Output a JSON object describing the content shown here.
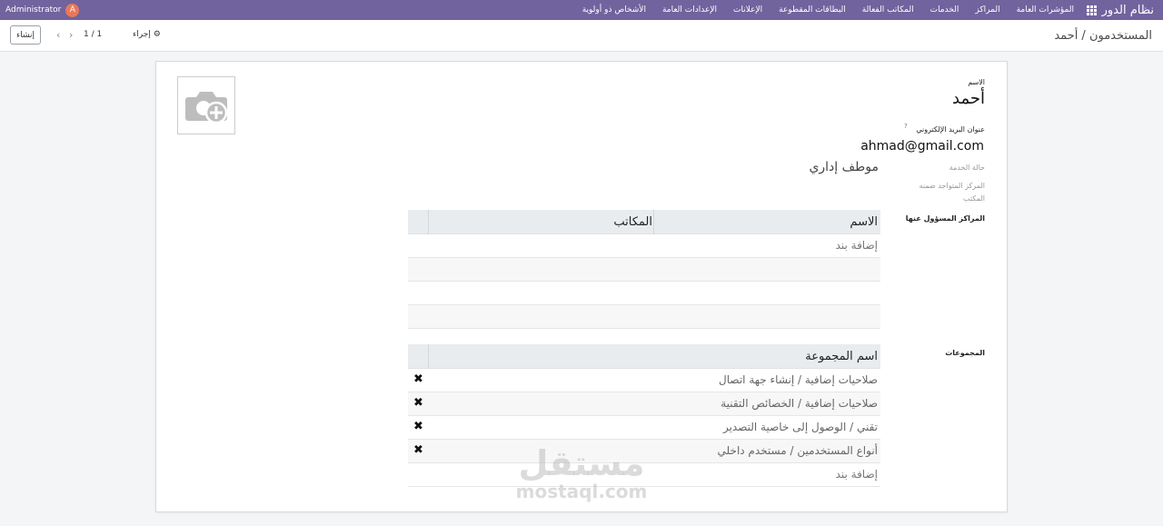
{
  "navbar": {
    "brand": "نظام الدور",
    "menu": [
      "المؤشرات العامة",
      "المراكز",
      "الخدمات",
      "المكاتب الفعالة",
      "البطاقات المقطوعة",
      "الإعلانات",
      "الإعدادات العامة",
      "الأشخاص ذو أولوية"
    ],
    "user_name": "Administrator",
    "user_initial": "A"
  },
  "control": {
    "breadcrumb": "المستخدمون / أحمد",
    "create_label": "إنشاء",
    "pager": "1 / 1",
    "action_label": "إجراء"
  },
  "form": {
    "name_label": "الاسم",
    "name_value": "أحمد",
    "email_label": "عنوان البريد الإلكتروني",
    "email_help": "?",
    "email_value": "ahmad@gmail.com",
    "service_label": "حالة الخدمة",
    "service_value": "موطف إداري",
    "center_label_1": "المركز المتواجد ضمنه",
    "center_label_2": "المكتب",
    "responsible_label": "المراكز المسؤول عنها",
    "groups_label": "المجموعات"
  },
  "centers_table": {
    "col_name": "الاسم",
    "col_offices": "المكاتب",
    "add_line": "إضافة بند"
  },
  "groups_table": {
    "col_name": "اسم المجموعة",
    "rows": [
      "صلاحيات إضافية / إنشاء جهة اتصال",
      "صلاحيات إضافية / الخصائص التقنية",
      "تقني / الوصول إلى خاصية التصدير",
      "أنواع المستخدمين / مستخدم داخلي"
    ],
    "add_line": "إضافة بند"
  },
  "watermark": {
    "ar": "مستقل",
    "en": "mostaql.com"
  },
  "colors": {
    "navbar": "#71639e",
    "avatar": "#e9785a",
    "table_header": "#e9ecef"
  }
}
